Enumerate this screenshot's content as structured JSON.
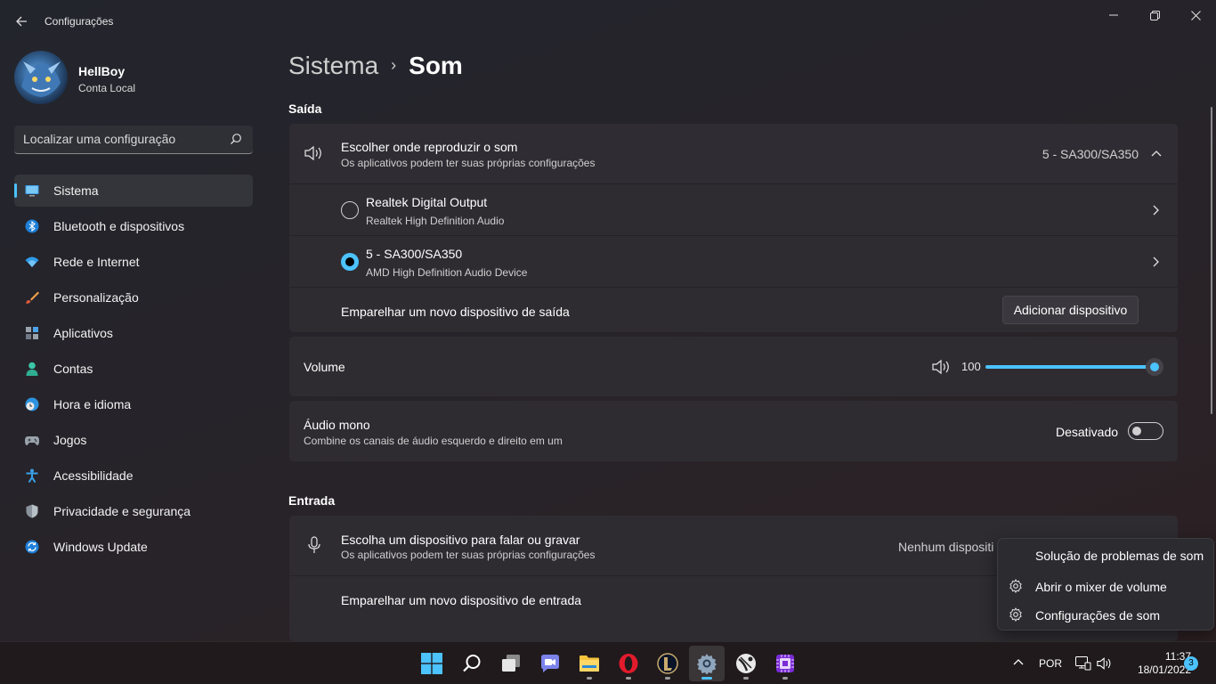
{
  "window": {
    "title": "Configurações"
  },
  "profile": {
    "name": "HellBoy",
    "account_type": "Conta Local"
  },
  "search": {
    "placeholder": "Localizar uma configuração"
  },
  "nav": {
    "items": [
      {
        "label": "Sistema",
        "icon": "monitor-icon"
      },
      {
        "label": "Bluetooth e dispositivos",
        "icon": "bluetooth-icon"
      },
      {
        "label": "Rede e Internet",
        "icon": "wifi-icon"
      },
      {
        "label": "Personalização",
        "icon": "brush-icon"
      },
      {
        "label": "Aplicativos",
        "icon": "apps-icon"
      },
      {
        "label": "Contas",
        "icon": "person-icon"
      },
      {
        "label": "Hora e idioma",
        "icon": "clock-globe-icon"
      },
      {
        "label": "Jogos",
        "icon": "gamepad-icon"
      },
      {
        "label": "Acessibilidade",
        "icon": "accessibility-icon"
      },
      {
        "label": "Privacidade e segurança",
        "icon": "shield-icon"
      },
      {
        "label": "Windows Update",
        "icon": "update-icon"
      }
    ]
  },
  "breadcrumb": {
    "parent": "Sistema",
    "current": "Som"
  },
  "output": {
    "section_title": "Saída",
    "choose_title": "Escolher onde reproduzir o som",
    "choose_sub": "Os aplicativos podem ter suas próprias configurações",
    "selected_device": "5 - SA300/SA350",
    "devices": [
      {
        "name": "Realtek Digital Output",
        "driver": "Realtek High Definition Audio",
        "selected": false
      },
      {
        "name": "5 - SA300/SA350",
        "driver": "AMD High Definition Audio Device",
        "selected": true
      }
    ],
    "pair_label": "Emparelhar um novo dispositivo de saída",
    "add_button": "Adicionar dispositivo"
  },
  "volume": {
    "label": "Volume",
    "value": "100",
    "accent": "#4cc2ff"
  },
  "mono": {
    "title": "Áudio mono",
    "sub": "Combine os canais de áudio esquerdo e direito em um",
    "state": "Desativado"
  },
  "input": {
    "section_title": "Entrada",
    "choose_title": "Escolha um dispositivo para falar ou gravar",
    "choose_sub": "Os aplicativos podem ter suas próprias configurações",
    "selected_device": "Nenhum dispositi",
    "pair_label": "Emparelhar um novo dispositivo de entrada"
  },
  "context_menu": {
    "items": [
      {
        "label": "Solução de problemas de som",
        "icon": ""
      },
      {
        "label": "Abrir o mixer de volume",
        "icon": "gear-icon"
      },
      {
        "label": "Configurações de som",
        "icon": "gear-icon"
      }
    ]
  },
  "taskbar": {
    "language": "POR",
    "time": "11:37",
    "date": "18/01/2022",
    "notifications": "3"
  }
}
